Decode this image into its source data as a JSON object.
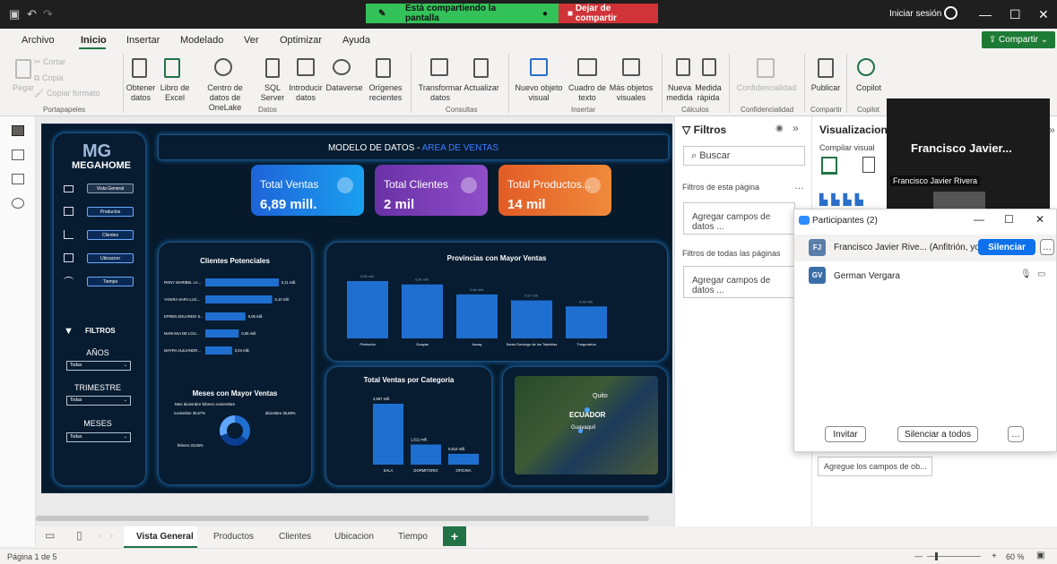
{
  "titlebar": {
    "share_status": "Está compartiendo la pantalla",
    "stop_share": "Dejar de compartir",
    "signin": "Iniciar sesión"
  },
  "menu": [
    "Archivo",
    "Inicio",
    "Insertar",
    "Modelado",
    "Ver",
    "Optimizar",
    "Ayuda"
  ],
  "share_button": "Compartir",
  "ribbon": {
    "pegar": "Pegar",
    "cortar": "Cortar",
    "copia": "Copia",
    "copiar_formato": "Copiar formato",
    "obtener_datos": "Obtener datos",
    "libro_excel": "Libro de Excel",
    "onelake": "Centro de datos de OneLake",
    "sql": "SQL Server",
    "introducir": "Introducir datos",
    "dataverse": "Dataverse",
    "origenes": "Orígenes recientes",
    "transformar": "Transformar datos",
    "actualizar": "Actualizar",
    "nuevo_visual": "Nuevo objeto visual",
    "cuadro_texto": "Cuadro de texto",
    "mas_visuales": "Más objetos visuales",
    "nueva_medida": "Nueva medida",
    "medida_rapida": "Medida rápida",
    "confidencialidad": "Confidencialidad",
    "publicar": "Publicar",
    "copilot": "Copilot",
    "groups": {
      "portapapeles": "Portapapeles",
      "datos": "Datos",
      "consultas": "Consultas",
      "insertar": "Insertar",
      "calculos": "Cálculos",
      "confidencialidad": "Confidencialidad",
      "compartir": "Compartir",
      "copilot": "Copilot"
    }
  },
  "report": {
    "brand": "MEGAHOME",
    "title_main": "MODELO DE DATOS -",
    "title_accent": "AREA DE VENTAS",
    "nav": [
      "Vista General",
      "Productos",
      "Clientes",
      "Ubicacion",
      "Tiempo"
    ],
    "filtros_label": "FILTROS",
    "slicers": [
      {
        "label": "AÑOS",
        "value": "Todas"
      },
      {
        "label": "TRIMESTRE",
        "value": "Todas"
      },
      {
        "label": "MESES",
        "value": "Todas"
      }
    ],
    "cards": [
      {
        "label": "Total Ventas",
        "value": "6,89 mill."
      },
      {
        "label": "Total Clientes",
        "value": "2 mil"
      },
      {
        "label": "Total Productos...",
        "value": "14 mil"
      }
    ],
    "clientes_title": "Clientes Potenciales",
    "provincias_title": "Provincias con Mayor Ventas",
    "categoria_title": "Total Ventas por Categoría",
    "meses_title": "Meses con Mayor Ventas",
    "meses_legend": "Mes  diciembre  febrero  noviembre",
    "map_label_ecuador": "ECUADOR",
    "map_label_quito": "Quito",
    "map_label_guayaquil": "Guayaquil"
  },
  "chart_data": [
    {
      "type": "bar",
      "title": "Clientes Potenciales",
      "orientation": "horizontal",
      "categories": [
        "RONY MARIBEL LA...",
        "YANIRA SARA LUC...",
        "EFREN EDUARDO S...",
        "MARIANA DE LOU...",
        "MAYRA ALEJANDR..."
      ],
      "values": [
        0.11,
        0.1,
        0.06,
        0.05,
        0.04
      ],
      "labels": [
        "0,11 mill.",
        "0,10 mill.",
        "0,06 mill.",
        "0,05 mill.",
        "0,04 mill."
      ]
    },
    {
      "type": "bar",
      "title": "Provincias con Mayor Ventas",
      "categories": [
        "Pichincha",
        "Guayas",
        "Azuay",
        "Santo Domingo de los Tsáchilas",
        "Tungurahua"
      ],
      "values": [
        0.86,
        0.81,
        0.66,
        0.57,
        0.48
      ],
      "labels": [
        "0,86 mill.",
        "0,81 mill.",
        "0,66 mill.",
        "0,57 mill.",
        "0,48 mill."
      ]
    },
    {
      "type": "bar",
      "title": "Total Ventas por Categoría",
      "categories": [
        "SALA",
        "DORMITORIO",
        "OFICINA"
      ],
      "values": [
        4.567,
        1.511,
        0.814
      ],
      "labels": [
        "4,567 mill.",
        "1,511 mill.",
        "0,814 mill."
      ]
    },
    {
      "type": "pie",
      "title": "Meses con Mayor Ventas",
      "categories": [
        "diciembre",
        "febrero",
        "noviembre"
      ],
      "values": [
        35.68,
        33.65,
        30.67
      ],
      "labels": [
        "diciembre 35,68%",
        "febrero 33,65%",
        "noviembre 30,67%"
      ],
      "colors": [
        "#1f6fd1",
        "#0b3d91",
        "#60a5ff"
      ]
    }
  ],
  "filters_pane": {
    "title": "Filtros",
    "search": "Buscar",
    "page_filters": "Filtros de esta página",
    "all_pages": "Filtros de todas las páginas",
    "add_fields": "Agregar campos de datos ..."
  },
  "viz_pane": {
    "title": "Visualizacione",
    "build": "Compilar visual",
    "add_fields": "Agregue los campos de ob..."
  },
  "video": {
    "name_big": "Francisco  Javier...",
    "name_small": "Francisco Javier Rivera"
  },
  "participants": {
    "title": "Participantes (2)",
    "people": [
      {
        "initials": "FJ",
        "name": "Francisco Javier Rive... (Anfitrión, yo)",
        "color": "#5a7fa8"
      },
      {
        "initials": "GV",
        "name": "German Vergara",
        "color": "#3a6ea8"
      }
    ],
    "mute": "Silenciar",
    "invite": "Invitar",
    "mute_all": "Silenciar a todos"
  },
  "tabs": [
    "Vista General",
    "Productos",
    "Clientes",
    "Ubicacion",
    "Tiempo"
  ],
  "status": {
    "page": "Página 1 de 5",
    "zoom": "60 %"
  }
}
